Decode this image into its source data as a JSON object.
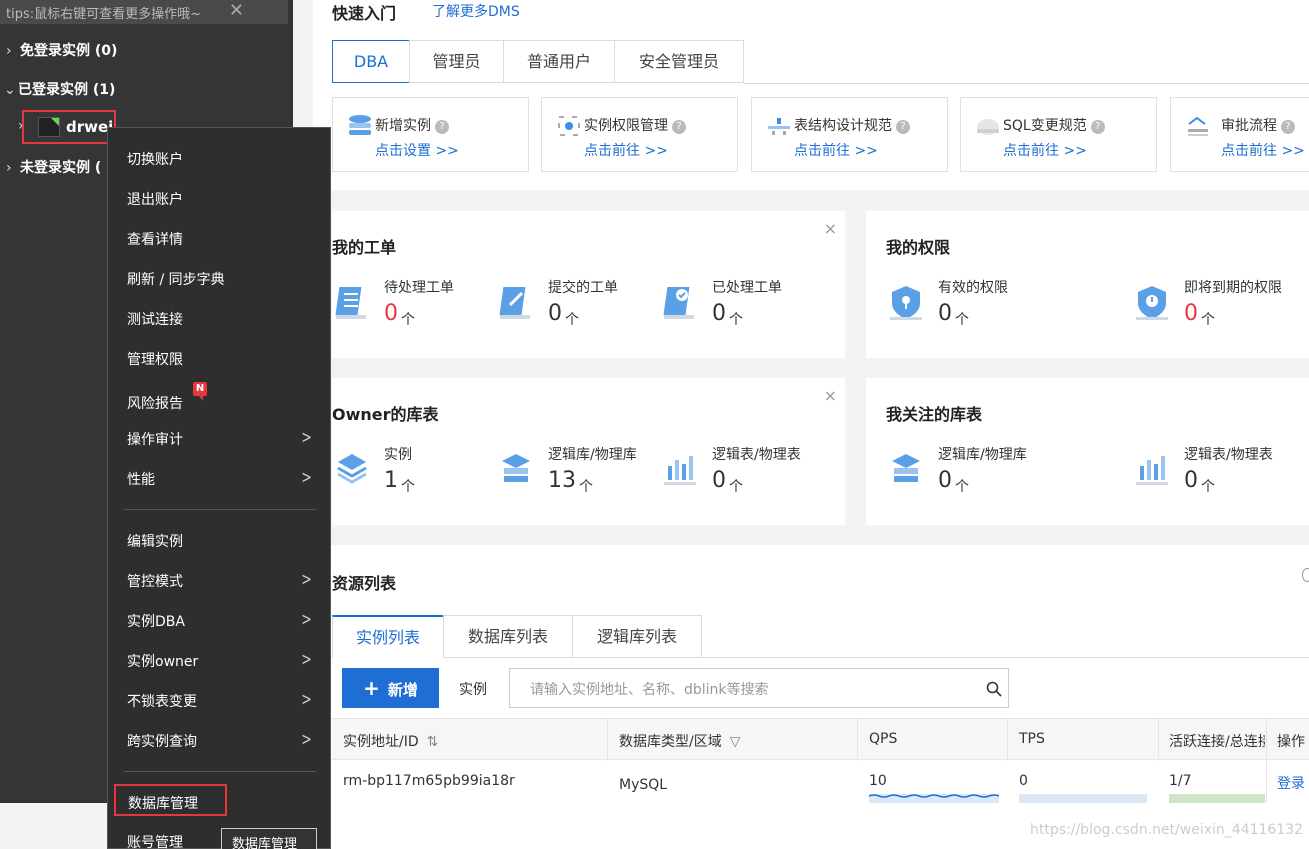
{
  "sidebar": {
    "tips": "tips:鼠标右键可查看更多操作哦~",
    "groups": [
      {
        "label": "免登录实例 (0)"
      },
      {
        "label": "已登录实例 (1)"
      },
      {
        "label": "未登录实例 ("
      }
    ],
    "instance": "drwei"
  },
  "context_menu": {
    "items": [
      "切换账户",
      "退出账户",
      "查看详情",
      "刷新 / 同步字典",
      "测试连接",
      "管理权限",
      "风险报告",
      "操作审计",
      "性能",
      "编辑实例",
      "管控模式",
      "实例DBA",
      "实例owner",
      "不锁表变更",
      "跨实例查询",
      "数据库管理",
      "账号管理"
    ],
    "badge": "N",
    "tooltip": "数据库管理"
  },
  "main": {
    "quickstart_title": "快速入门",
    "learn_more": "了解更多DMS",
    "role_tabs": [
      "DBA",
      "管理员",
      "普通用户",
      "安全管理员"
    ],
    "cards": [
      {
        "title": "新增实例",
        "link": "点击设置 >>"
      },
      {
        "title": "实例权限管理",
        "link": "点击前往 >>"
      },
      {
        "title": "表结构设计规范",
        "link": "点击前往 >>"
      },
      {
        "title": "SQL变更规范",
        "link": "点击前往 >>"
      },
      {
        "title": "审批流程",
        "link": "点击前往 >>"
      }
    ],
    "my_tickets": {
      "title": "我的工单",
      "items": [
        {
          "label": "待处理工单",
          "value": "0"
        },
        {
          "label": "提交的工单",
          "value": "0"
        },
        {
          "label": "已处理工单",
          "value": "0"
        }
      ]
    },
    "my_perms": {
      "title": "我的权限",
      "items": [
        {
          "label": "有效的权限",
          "value": "0"
        },
        {
          "label": "即将到期的权限",
          "value": "0"
        }
      ]
    },
    "owner_tables": {
      "title": "Owner的库表",
      "items": [
        {
          "label": "实例",
          "value": "1"
        },
        {
          "label": "逻辑库/物理库",
          "value": "13"
        },
        {
          "label": "逻辑表/物理表",
          "value": "0"
        }
      ]
    },
    "followed_tables": {
      "title": "我关注的库表",
      "items": [
        {
          "label": "逻辑库/物理库",
          "value": "0"
        },
        {
          "label": "逻辑表/物理表",
          "value": "0"
        }
      ]
    },
    "unit": "个",
    "close_symbol": "×",
    "resource": {
      "title": "资源列表",
      "tabs": [
        "实例列表",
        "数据库列表",
        "逻辑库列表"
      ],
      "new_button": "新增",
      "filter_label": "实例",
      "search_placeholder": "请输入实例地址、名称、dblink等搜索",
      "columns": [
        "实例地址/ID",
        "数据库类型/区域",
        "QPS",
        "TPS",
        "活跃连接/总连接",
        "操作"
      ],
      "row": {
        "address": "rm-bp117m65pb99ia18r",
        "db_type": "MySQL",
        "qps": "10",
        "tps": "0",
        "conn": "1/7",
        "action": "登录"
      }
    }
  },
  "watermark": "https://blog.csdn.net/weixin_44116132",
  "colors": {
    "accent": "#1e6ed4",
    "danger": "#e4393c",
    "sidebar_bg": "#353535"
  }
}
